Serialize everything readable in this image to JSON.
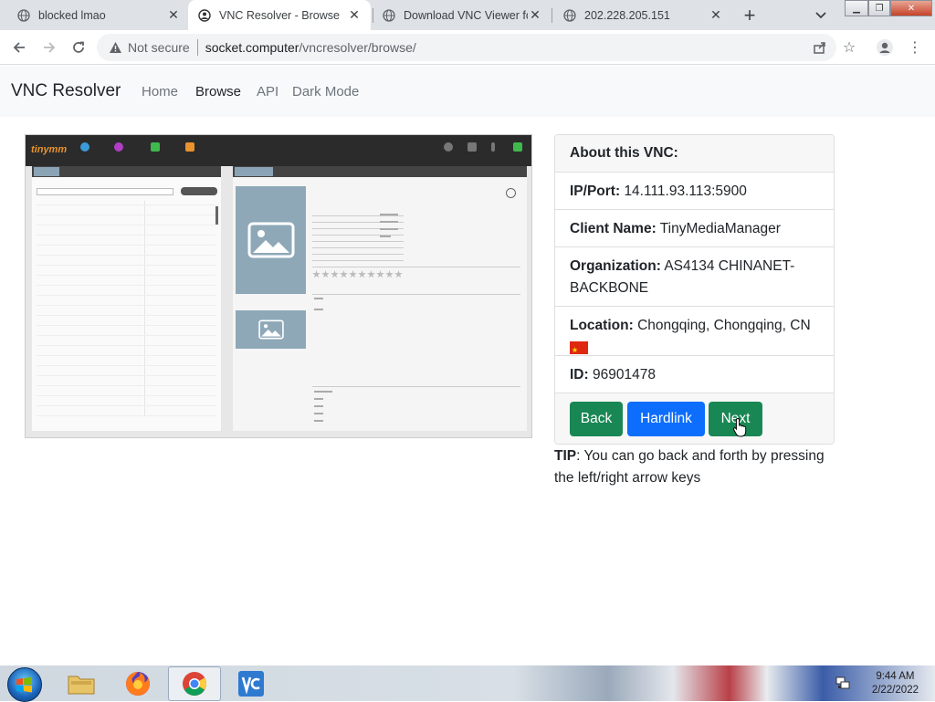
{
  "browser": {
    "tabs": [
      {
        "title": "blocked lmao",
        "active": false
      },
      {
        "title": "VNC Resolver - Browse",
        "active": true
      },
      {
        "title": "Download VNC Viewer fo",
        "active": false
      },
      {
        "title": "202.228.205.151",
        "active": false
      }
    ],
    "address": {
      "security_label": "Not secure",
      "host": "socket.computer",
      "path": "/vncresolver/browse/"
    }
  },
  "site": {
    "brand": "VNC Resolver",
    "nav": [
      "Home",
      "Browse",
      "API",
      "Dark Mode"
    ],
    "active_nav": "Browse"
  },
  "preview": {
    "logo": "tinymm"
  },
  "card": {
    "heading": "About this VNC:",
    "ip_label": "IP/Port:",
    "ip_value": "14.111.93.113:5900",
    "client_label": "Client Name:",
    "client_value": "TinyMediaManager",
    "org_label": "Organization:",
    "org_value": "AS4134 CHINANET-BACKBONE",
    "location_label": "Location:",
    "location_value": "Chongqing, Chongqing, CN",
    "id_label": "ID:",
    "id_value": "96901478",
    "buttons": {
      "back": "Back",
      "hardlink": "Hardlink",
      "next": "Next"
    }
  },
  "tip": {
    "label": "TIP",
    "text": ": You can go back and forth by pressing the left/right arrow keys"
  },
  "taskbar": {
    "time": "9:44 AM",
    "date": "2/22/2022",
    "items": [
      "file-explorer",
      "firefox",
      "chrome",
      "vnc-viewer"
    ]
  },
  "colors": {
    "green": "#198754",
    "blue": "#0d6efd",
    "flag_red": "#de2910"
  }
}
